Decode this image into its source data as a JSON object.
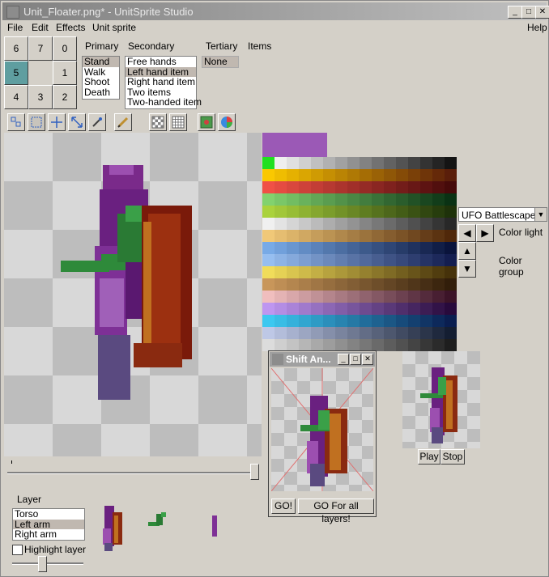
{
  "window": {
    "title": "Unit_Floater.png* - UnitSprite Studio"
  },
  "titlebar_buttons": {
    "minimize": "_",
    "maximize": "□",
    "close": "✕"
  },
  "menu": {
    "file": "File",
    "edit": "Edit",
    "effects": "Effects",
    "unit_sprite": "Unit sprite",
    "help": "Help"
  },
  "direction_pad": {
    "b6": "6",
    "b7": "7",
    "b0": "0",
    "b5": "5",
    "b1": "1",
    "b4": "4",
    "b3": "3",
    "b2": "2",
    "selected": "5"
  },
  "headers": {
    "primary": "Primary",
    "secondary": "Secondary",
    "tertiary": "Tertiary",
    "items": "Items"
  },
  "primary_list": [
    "Stand",
    "Walk",
    "Shoot",
    "Death"
  ],
  "secondary_list": [
    "Free hands",
    "Left hand item",
    "Right hand item",
    "Two items",
    "Two-handed item"
  ],
  "tertiary_list": [
    "None"
  ],
  "palette": {
    "scheme": "UFO Battlescape",
    "color_light_label": "Color light",
    "color_group_label": "Color group",
    "selected_color": "#9b59b6"
  },
  "shift_dialog": {
    "title": "Shift An...",
    "go_label": "GO!",
    "go_all_label": "GO For all layers!"
  },
  "preview": {
    "play_label": "Play",
    "stop_label": "Stop"
  },
  "layer": {
    "label": "Layer",
    "items": [
      "Torso",
      "Left arm",
      "Right arm"
    ],
    "selected": "Left arm",
    "highlight_label": "Highlight layer"
  }
}
